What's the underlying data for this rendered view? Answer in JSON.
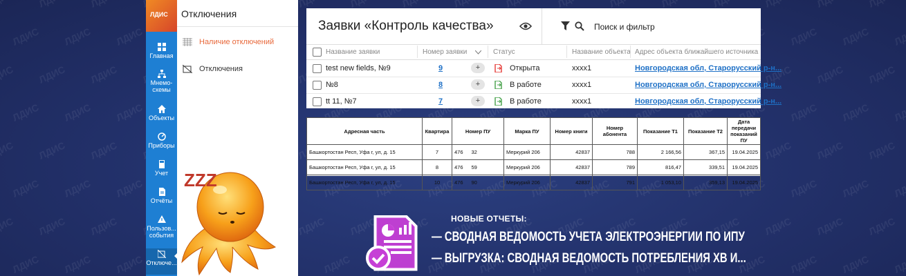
{
  "brand": {
    "logo_text": "ЛДИС"
  },
  "rail": [
    {
      "label": "Главная",
      "icon": "grid-icon"
    },
    {
      "label": "Мнемо-\nсхемы",
      "icon": "hierarchy-icon"
    },
    {
      "label": "Объекты",
      "icon": "home-icon"
    },
    {
      "label": "Приборы",
      "icon": "gauge-icon"
    },
    {
      "label": "Учет",
      "icon": "calculator-icon"
    },
    {
      "label": "Отчёты",
      "icon": "document-icon"
    },
    {
      "label": "Пользов...\nсобытия",
      "icon": "warning-icon"
    },
    {
      "label": "Отключе...",
      "icon": "outage-icon"
    }
  ],
  "sidebar": {
    "title": "Отключения",
    "items": [
      {
        "label": "Наличие отключений",
        "icon": "grid-list-icon"
      },
      {
        "label": "Отключения",
        "icon": "outage-icon"
      }
    ]
  },
  "requests": {
    "title": "Заявки «Контроль качества»",
    "search_placeholder": "Поиск и фильтр",
    "columns": [
      "Название заявки",
      "Номер заявки",
      "Статус",
      "Название объекта",
      "Адрес объекта ближайшего источника"
    ],
    "rows": [
      {
        "name": "test new fields, №9",
        "number": "9",
        "status": "Открыта",
        "status_color": "#e53935",
        "object": "xxxx1",
        "address": "Новгородская обл, Старорусский р-н..."
      },
      {
        "name": "№8",
        "number": "8",
        "status": "В работе",
        "status_color": "#43a047",
        "object": "xxxx1",
        "address": "Новгородская обл, Старорусский р-н..."
      },
      {
        "name": "tt 11, №7",
        "number": "7",
        "status": "В работе",
        "status_color": "#43a047",
        "object": "xxxx1",
        "address": "Новгородская обл, Старорусский р-н..."
      }
    ]
  },
  "report": {
    "headers": [
      "Адресная часть",
      "Квартира",
      "Номер ПУ",
      "Марка ПУ",
      "Номер книги",
      "Номер абонента",
      "Показание Т1",
      "Показание Т2",
      "Дата передачи показаний ПУ"
    ],
    "rows": [
      {
        "address": "Башкортостан Респ, Уфа г,                 ул, д. 15",
        "apt": "7",
        "pu_a": "476",
        "pu_b": "32",
        "brand": "Меркурий 206",
        "book": "42837",
        "abonent": "788",
        "t1": "2 166,56",
        "t2": "367,15",
        "date": "19.04.2025"
      },
      {
        "address": "Башкортостан Респ, Уфа г,                 ул, д. 15",
        "apt": "8",
        "pu_a": "476",
        "pu_b": "59",
        "brand": "Меркурий 206",
        "book": "42837",
        "abonent": "789",
        "t1": "816,47",
        "t2": "339,51",
        "date": "19.04.2025"
      },
      {
        "address": "Башкортостан Респ, Уфа г,                 ул, д. 15",
        "apt": "10",
        "pu_a": "476",
        "pu_b": "90",
        "brand": "Меркурий 206",
        "book": "42837",
        "abonent": "791",
        "t1": "1 053,10",
        "t2": "359,13",
        "date": "19.04.2025"
      }
    ]
  },
  "announcement": {
    "heading": "НОВЫЕ ОТЧЕТЫ:",
    "lines": [
      "— СВОДНАЯ ВЕДОМОСТЬ УЧЕТА ЭЛЕКТРОЭНЕРГИИ ПО ИПУ",
      "— ВЫГРУЗКА: СВОДНАЯ ВЕДОМОСТЬ ПОТРЕБЛЕНИЯ ХВ И..."
    ],
    "accent": "#c63fd6"
  },
  "mascot": {
    "sleep_text": "ZZZ"
  },
  "watermark": "ЛДИС"
}
